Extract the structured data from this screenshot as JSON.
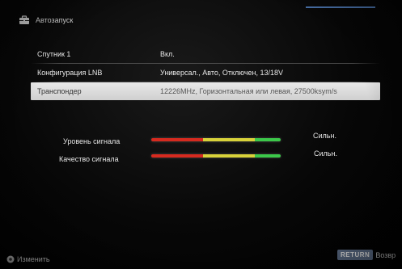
{
  "header": {
    "title": "Автозапуск",
    "icon": "toolbox-icon"
  },
  "rows": [
    {
      "label": "Спутник 1",
      "value": "Вкл."
    },
    {
      "label": "Конфигурация LNB",
      "value": "Универсал., Авто, Отключен, 13/18V"
    },
    {
      "label": "Транспондер",
      "value": "12226MHz, Горизонтальная или левая, 27500ksym/s",
      "selected": true
    }
  ],
  "signal": {
    "strength": {
      "label": "Уровень сигнала",
      "status": "Сильн.",
      "level": 1.0
    },
    "quality": {
      "label": "Качество сигнала",
      "status": "Сильн.",
      "level": 1.0
    }
  },
  "footer": {
    "change_label": "Изменить",
    "change_icon": "dpad-icon",
    "return_key": "RETURN",
    "return_label": "Возвр"
  },
  "colors": {
    "meter_red": "#d62a1f",
    "meter_yellow": "#d8d23a",
    "meter_green": "#3cc84a",
    "selection": "#e0e0e0",
    "accent": "#5b8fd6"
  }
}
